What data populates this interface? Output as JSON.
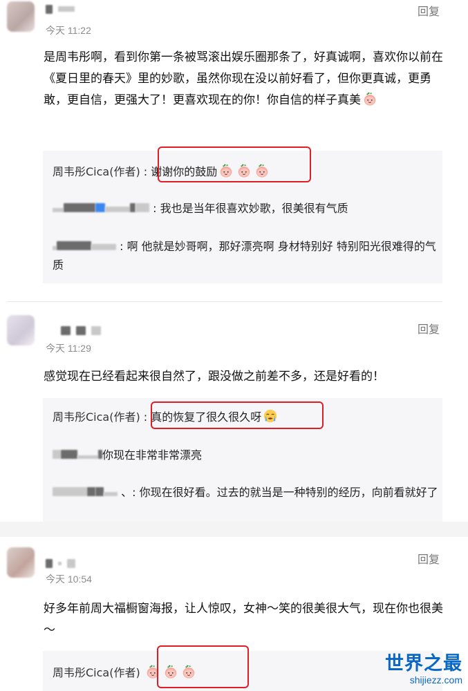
{
  "reply_label": "回复",
  "comments": [
    {
      "time": "今天 11:22",
      "text": "是周韦彤啊，看到你第一条被骂滚出娱乐圈那条了，好真诚啊，喜欢你以前在《夏日里的春天》里的妙歌，虽然你现在没以前好看了，但你更真诚，更勇敢，更自信，更强大了！更喜欢现在的你！你自信的样子真美",
      "replies": [
        {
          "author": "周韦彤Cica(作者)",
          "text": "谢谢你的鼓励"
        },
        {
          "text": "我也是当年很喜欢妙歌，很美很有气质"
        },
        {
          "text": "啊 他就是妙哥啊，那好漂亮啊 身材特别好 特别阳光很难得的气质"
        }
      ]
    },
    {
      "time": "今天 11:29",
      "text": "感觉现在已经看起来很自然了，跟没做之前差不多，还是好看的！",
      "replies": [
        {
          "author": "周韦彤Cica(作者)",
          "text": "真的恢复了很久很久呀"
        },
        {
          "text": "你现在非常非常漂亮"
        },
        {
          "text": "你现在很好看。过去的就当是一种特别的经历，向前看就好了"
        }
      ]
    },
    {
      "time": "今天 10:54",
      "text": "好多年前周大福橱窗海报，让人惊叹，女神～笑的很美很大气，现在你也很美～",
      "replies": [
        {
          "author": "周韦彤Cica(作者)",
          "text": ""
        }
      ]
    }
  ],
  "watermark": {
    "cn": "世界之最",
    "en": "shijiezz.com"
  },
  "colors": {
    "highlight": "#e01c24",
    "watermark": "#0b67c4",
    "reply_bg": "#f6f6f8"
  }
}
